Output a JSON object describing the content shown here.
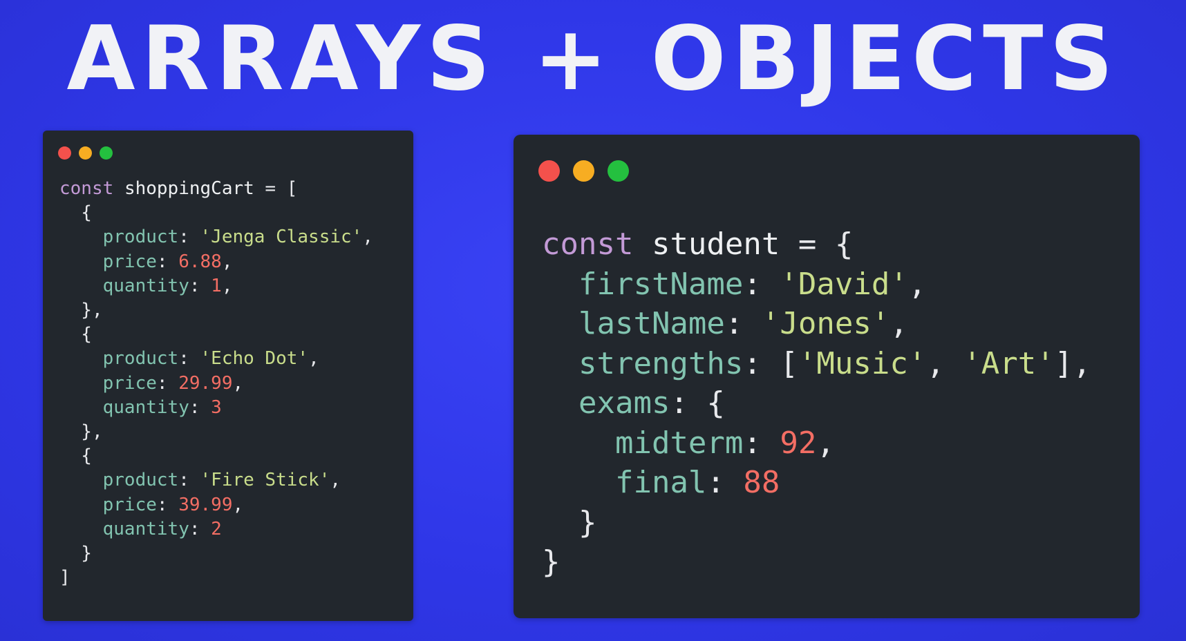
{
  "slide": {
    "title": "ARRAYS + OBJECTS"
  },
  "colors": {
    "background": "#2f37e8",
    "window": "#22272d",
    "keyword": "#c39ad6",
    "property": "#82c4b0",
    "string": "#c9dd8b",
    "number": "#f36e64",
    "dot_red": "#f4514c",
    "dot_yellow": "#f7ad22",
    "dot_green": "#24c03f"
  },
  "left_window": {
    "code": {
      "keyword": "const",
      "name": "shoppingCart",
      "items": [
        {
          "product": "'Jenga Classic'",
          "price": "6.88",
          "quantity": "1"
        },
        {
          "product": "'Echo Dot'",
          "price": "29.99",
          "quantity": "3"
        },
        {
          "product": "'Fire Stick'",
          "price": "39.99",
          "quantity": "2"
        }
      ],
      "keys": {
        "product": "product",
        "price": "price",
        "quantity": "quantity"
      }
    }
  },
  "right_window": {
    "code": {
      "keyword": "const",
      "name": "student",
      "firstName_key": "firstName",
      "firstName_value": "'David'",
      "lastName_key": "lastName",
      "lastName_value": "'Jones'",
      "strengths_key": "strengths",
      "strengths_values": [
        "'Music'",
        "'Art'"
      ],
      "exams_key": "exams",
      "midterm_key": "midterm",
      "midterm_value": "92",
      "final_key": "final",
      "final_value": "88"
    }
  }
}
